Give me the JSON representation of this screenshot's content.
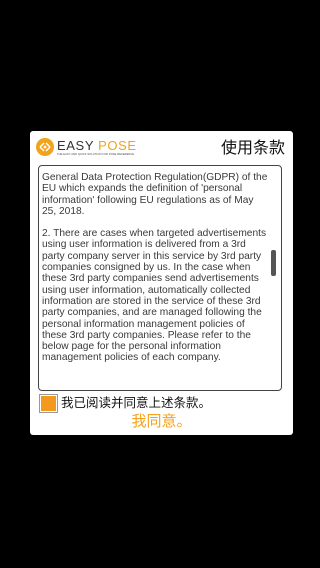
{
  "header": {
    "logo_word1": "EASY",
    "logo_word2": "POSE",
    "logo_tagline": "THE EASY AND QUICK SOLUTION FOR POSE REFERENCE",
    "title": "使用条款"
  },
  "terms": {
    "paragraphs": [
      "General Data Protection Regulation(GDPR) of the EU which expands the definition of 'personal information' following EU regulations as of May 25, 2018.",
      "2. There are cases when targeted advertisements using user information is delivered from a 3rd party company server in this service by 3rd party companies consigned by us. In the case when these 3rd party companies send advertisements using user information, automatically collected information are stored in the service of these 3rd party companies, and are managed following the personal information management policies of these 3rd party companies. Please refer to the below page for the personal information management policies of each company."
    ]
  },
  "agree": {
    "checkbox_checked": true,
    "label": "我已阅读并同意上述条款。",
    "button_label": "我同意。"
  },
  "colors": {
    "background": "#000000",
    "dialog": "#ffffff",
    "accent": "#f3a21c",
    "checkbox": "#f39a1e"
  },
  "icons": {
    "logo": "easy-pose-logo-icon",
    "checkbox": "checkbox-icon"
  }
}
